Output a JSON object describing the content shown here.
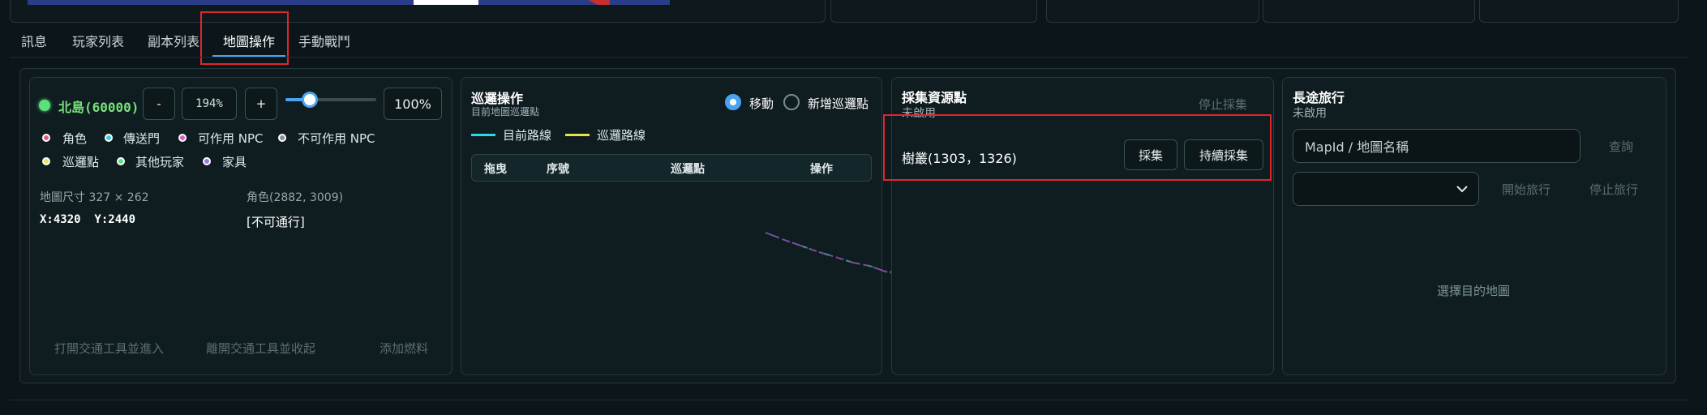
{
  "tabs": [
    {
      "label": "訊息"
    },
    {
      "label": "玩家列表"
    },
    {
      "label": "副本列表"
    },
    {
      "label": "地圖操作"
    },
    {
      "label": "手動戰鬥"
    }
  ],
  "map_panel": {
    "map_name": "北島(60000)",
    "zoom_minus": "-",
    "zoom_value": "194%",
    "zoom_plus": "+",
    "slider_level_percent": 35,
    "reset_zoom": "100%",
    "legend": [
      {
        "label": "角色",
        "color": "#e85a78"
      },
      {
        "label": "傳送門",
        "color": "#31d2e0"
      },
      {
        "label": "可作用 NPC",
        "color": "#e05ac8"
      },
      {
        "label": "不可作用 NPC",
        "color": "#8a8f96"
      },
      {
        "label": "巡邏點",
        "color": "#e8e66a"
      },
      {
        "label": "其他玩家",
        "color": "#5ce07a"
      },
      {
        "label": "家具",
        "color": "#9a7ae0"
      }
    ],
    "map_size": "地圖尺寸 327 × 262",
    "role_pos": "角色(2882, 3009)",
    "cursor_pos": "X:4320  Y:2440",
    "passable": "[不可通行]",
    "actions": [
      "打開交通工具並進入",
      "離開交通工具並收起",
      "添加燃料"
    ],
    "status_color": "#5ce07a"
  },
  "patrol_panel": {
    "title": "巡邏操作",
    "subtitle": "目前地圖巡邏點",
    "radio_move": "移動",
    "radio_add": "新增巡邏點",
    "legend_current": "目前路線",
    "legend_patrol": "巡邏路線",
    "current_color": "#2fd6e6",
    "patrol_color": "#e6e24a",
    "table_headers": [
      "拖曳",
      "序號",
      "巡邏點",
      "操作"
    ]
  },
  "gather_panel": {
    "title": "採集資源點",
    "status": "未啟用",
    "stop": "停止採集",
    "resource": "樹叢(1303，1326)",
    "gather_btn": "採集",
    "continuous_btn": "持續採集"
  },
  "travel_panel": {
    "title": "長途旅行",
    "status": "未啟用",
    "input_placeholder": "MapId / 地圖名稱",
    "query": "查詢",
    "start": "開始旅行",
    "stop": "停止旅行",
    "hint": "選擇目的地圖"
  }
}
